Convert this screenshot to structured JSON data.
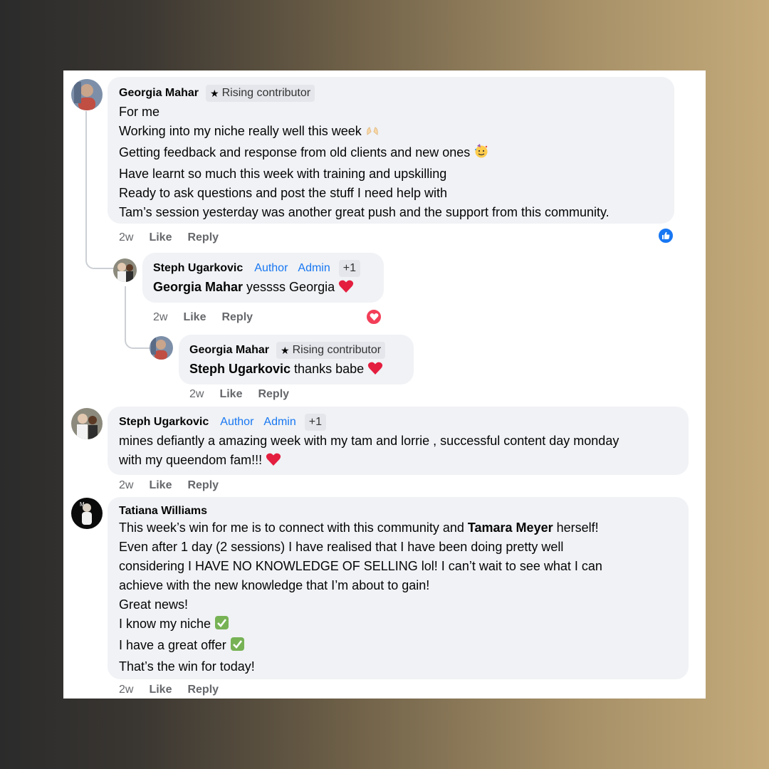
{
  "comments": [
    {
      "author": "Georgia Mahar",
      "badge": "Rising contributor",
      "lines": [
        "For me",
        "Working into my niche really well this week",
        "Getting feedback and response from old clients and new ones",
        "Have learnt so much this week with training and upskilling",
        "Ready to ask questions and post the stuff I need help with",
        "Tam’s session yesterday was another great push and the support from this community."
      ],
      "time": "2w",
      "like": "Like",
      "reply": "Reply",
      "reaction_icon": "like-reaction-icon"
    },
    {
      "author": "Steph Ugarkovic",
      "role1": "Author",
      "role2": "Admin",
      "extra": "+1",
      "mention": "Georgia Mahar",
      "text": " yessss Georgia",
      "time": "2w",
      "like": "Like",
      "reply": "Reply",
      "reaction_icon": "love-reaction-icon"
    },
    {
      "author": "Georgia Mahar",
      "badge": "Rising contributor",
      "mention": "Steph Ugarkovic",
      "text": " thanks babe",
      "time": "2w",
      "like": "Like",
      "reply": "Reply"
    },
    {
      "author": "Steph Ugarkovic",
      "role1": "Author",
      "role2": "Admin",
      "extra": "+1",
      "lines": [
        "mines defiantly a amazing week with my tam and lorrie , successful content day monday",
        "with my queendom fam!!!"
      ],
      "time": "2w",
      "like": "Like",
      "reply": "Reply"
    },
    {
      "author": "Tatiana Williams",
      "line1_pre": "This week’s win for me is to connect with this community and ",
      "line1_mention": "Tamara Meyer",
      "line1_post": " herself!",
      "lines": [
        "Even after 1 day (2 sessions) I have realised that I have been doing pretty well",
        "considering I HAVE NO KNOWLEDGE OF SELLING lol! I can’t wait to see what I can",
        "achieve with the new knowledge that I’m about to gain!",
        "Great news!",
        "I know my niche",
        "I have a great offer",
        "That’s the win for today!"
      ],
      "time": "2w",
      "like": "Like",
      "reply": "Reply"
    }
  ],
  "colors": {
    "link_blue": "#1877f2",
    "bubble_bg": "#f0f2f5",
    "meta_gray": "#65676b",
    "heart_red": "#e41e3f"
  }
}
